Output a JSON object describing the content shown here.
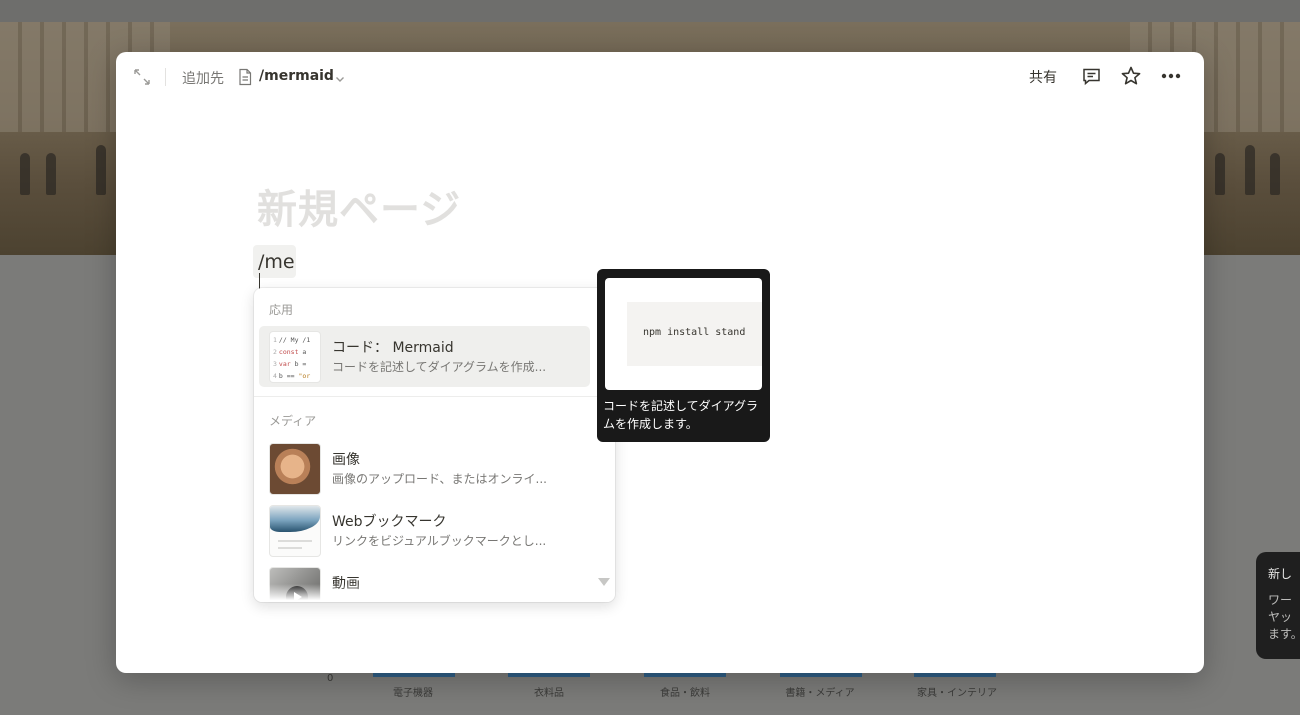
{
  "background": {
    "chart_zero": "0",
    "categories": [
      "電子機器",
      "衣料品",
      "食品・飲料",
      "書籍・メディア",
      "家具・インテリア"
    ],
    "toast": {
      "title": "新し",
      "body": "ワー\nヤッ\nます。"
    }
  },
  "topbar": {
    "add_to_label": "追加先",
    "target_page": "/mermaid",
    "share_label": "共有"
  },
  "page": {
    "title_placeholder": "新規ページ",
    "typed_command": "/me"
  },
  "slash_menu": {
    "section_apps": "応用",
    "section_media": "メディア",
    "items": [
      {
        "title": "コード： Mermaid",
        "description": "コードを記述してダイアグラムを作成..."
      },
      {
        "title": "画像",
        "description": "画像のアップロード、またはオンライ..."
      },
      {
        "title": "Webブックマーク",
        "description": "リンクをビジュアルブックマークとし..."
      },
      {
        "title": "動画",
        "description": ""
      }
    ],
    "code_thumb_lines": [
      {
        "n": "1",
        "code": "// My /1"
      },
      {
        "n": "2",
        "kw": "const",
        "code": " a"
      },
      {
        "n": "3",
        "kw": "var",
        "code": " b ="
      },
      {
        "n": "4",
        "code": "b == ",
        "st": "\"or"
      }
    ]
  },
  "preview": {
    "code": "npm install stand",
    "description": "コードを記述してダイアグラムを作成します。"
  },
  "colors": {
    "accent_bar": "#2f5f86",
    "modal_bg": "#ffffff",
    "tooltip_bg": "#191919"
  }
}
